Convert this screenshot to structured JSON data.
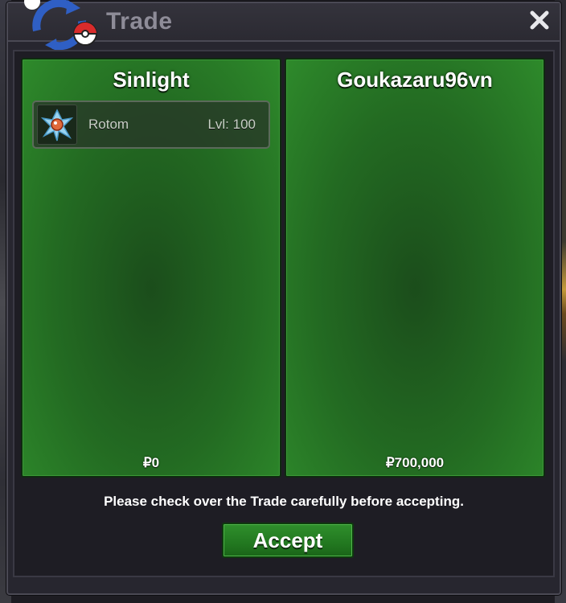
{
  "window": {
    "title": "Trade",
    "close_icon": "close-icon",
    "logo_icon": "trade-swap-logo-icon"
  },
  "left_panel": {
    "player_name": "Sinlight",
    "money": "₽0",
    "items": [
      {
        "icon": "rotom-icon",
        "name": "Rotom",
        "level": "Lvl: 100"
      }
    ]
  },
  "right_panel": {
    "player_name": "Goukazaru96vn",
    "money": "₽700,000",
    "items": []
  },
  "footer": {
    "notice": "Please check over the Trade carefully before accepting.",
    "accept_label": "Accept"
  },
  "colors": {
    "panel_green": "#236b22",
    "window_bg": "#27262f",
    "title_text": "#8e8c98",
    "accept_green": "#2f8f2c"
  }
}
